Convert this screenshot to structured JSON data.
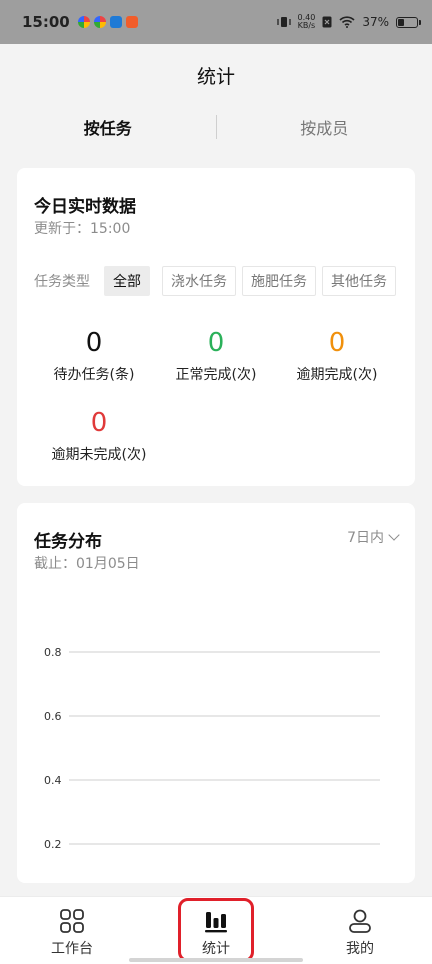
{
  "status_bar": {
    "time": "15:00",
    "net_speed_value": "0.40",
    "net_speed_unit": "KB/s",
    "battery": "37%"
  },
  "page": {
    "title": "统计"
  },
  "tabs": [
    {
      "label": "按任务",
      "active": true
    },
    {
      "label": "按成员",
      "active": false
    }
  ],
  "realtime": {
    "title": "今日实时数据",
    "updated": "更新于：15:00",
    "filter_label": "任务类型",
    "filters": [
      "全部",
      "浇水任务",
      "施肥任务",
      "其他任务"
    ],
    "selected_filter": "全部",
    "metrics": [
      {
        "value": "0",
        "label": "待办任务(条)",
        "color": "#111111"
      },
      {
        "value": "0",
        "label": "正常完成(次)",
        "color": "#2bb15a"
      },
      {
        "value": "0",
        "label": "逾期完成(次)",
        "color": "#f0900c"
      },
      {
        "value": "0",
        "label": "逾期未完成(次)",
        "color": "#e03a3a"
      }
    ]
  },
  "distribution": {
    "title": "任务分布",
    "deadline": "截止：01月05日",
    "range": "7日内"
  },
  "chart_data": {
    "type": "line",
    "title": "",
    "xlabel": "",
    "ylabel": "",
    "y_ticks": [
      "0.8",
      "0.6",
      "0.4",
      "0.2"
    ],
    "y_tick_values": [
      0.8,
      0.6,
      0.4,
      0.2
    ],
    "grid": true,
    "series": []
  },
  "bottom_nav": [
    {
      "label": "工作台",
      "icon": "grid-icon"
    },
    {
      "label": "统计",
      "icon": "bar-chart-icon",
      "active": true
    },
    {
      "label": "我的",
      "icon": "user-icon"
    }
  ],
  "colors": {
    "accent_green": "#2bb15a",
    "accent_orange": "#f0900c",
    "accent_red": "#e03a3a",
    "highlight": "#e0202a"
  }
}
